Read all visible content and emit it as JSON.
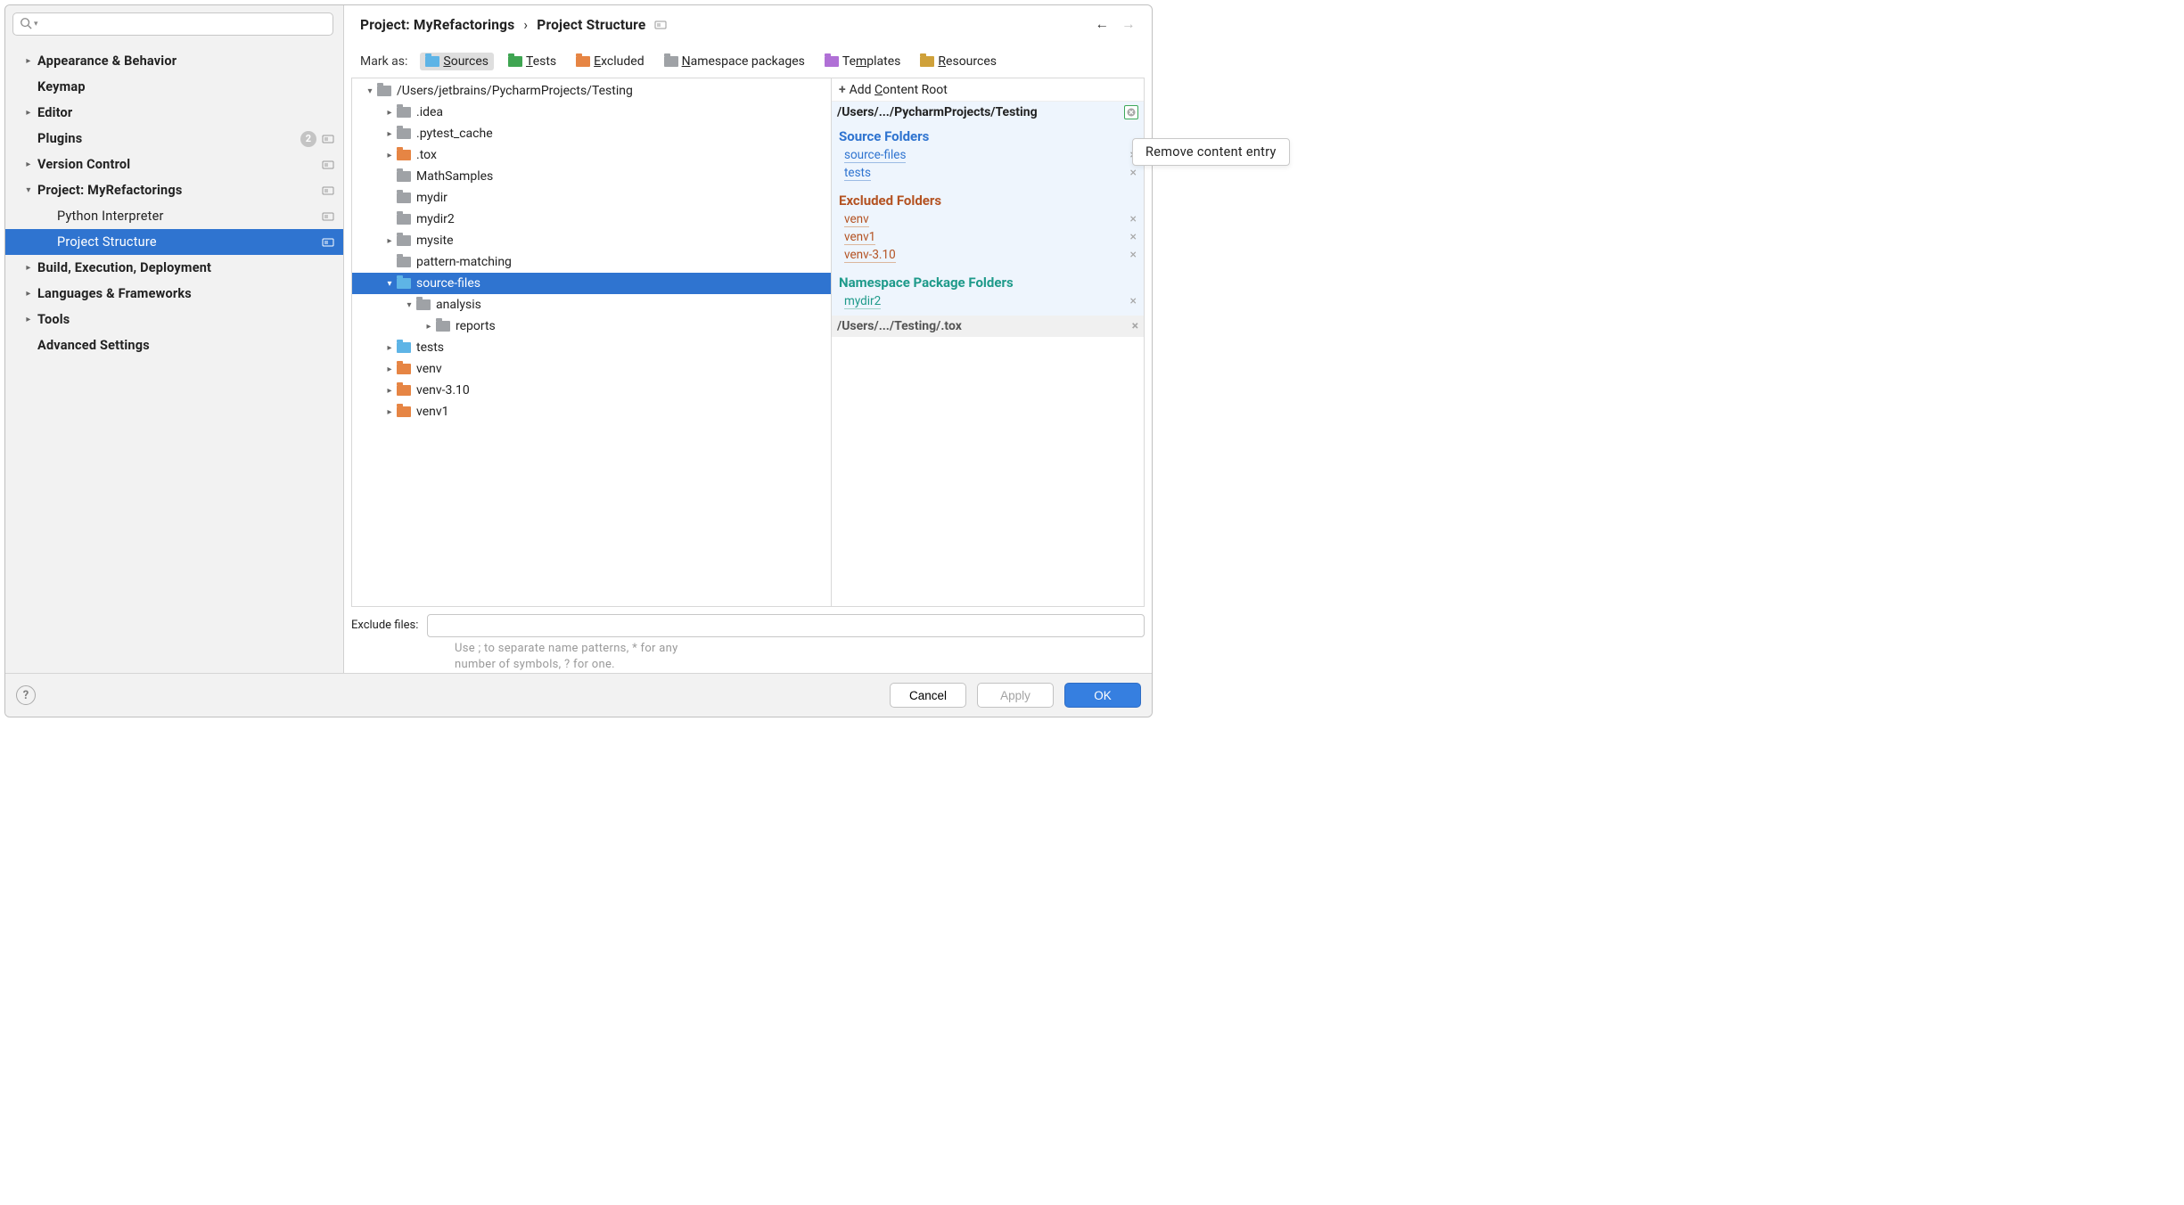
{
  "breadcrumb": {
    "part1": "Project: MyRefactorings",
    "sep": "›",
    "part2": "Project Structure"
  },
  "search": {
    "placeholder": ""
  },
  "sidebar": {
    "items": [
      {
        "label": "Appearance & Behavior",
        "arrow": "right"
      },
      {
        "label": "Keymap",
        "arrow": "none"
      },
      {
        "label": "Editor",
        "arrow": "right"
      },
      {
        "label": "Plugins",
        "arrow": "none",
        "badge": "2",
        "gear": true
      },
      {
        "label": "Version Control",
        "arrow": "right",
        "gear": true
      },
      {
        "label": "Project: MyRefactorings",
        "arrow": "down",
        "gear": true,
        "children": [
          {
            "label": "Python Interpreter",
            "gear": true
          },
          {
            "label": "Project Structure",
            "gear": true,
            "selected": true
          }
        ]
      },
      {
        "label": "Build, Execution, Deployment",
        "arrow": "right"
      },
      {
        "label": "Languages & Frameworks",
        "arrow": "right"
      },
      {
        "label": "Tools",
        "arrow": "right"
      },
      {
        "label": "Advanced Settings",
        "arrow": "none"
      }
    ]
  },
  "mark": {
    "label": "Mark as:",
    "items": [
      {
        "pre": "",
        "u": "S",
        "post": "ources",
        "color": "#5eb4e6",
        "selected": true
      },
      {
        "pre": "",
        "u": "T",
        "post": "ests",
        "color": "#3fa552"
      },
      {
        "pre": "",
        "u": "E",
        "post": "xcluded",
        "color": "#e68544"
      },
      {
        "pre": "",
        "u": "N",
        "post": "amespace packages",
        "color": "#9fa2a6"
      },
      {
        "pre": "Te",
        "u": "m",
        "post": "plates",
        "color": "#b070d6"
      },
      {
        "pre": "",
        "u": "R",
        "post": "esources",
        "color": "#cfa13a"
      }
    ]
  },
  "dirTree": [
    {
      "depth": 0,
      "arrow": "down",
      "color": "#9fa2a6",
      "label": "/Users/jetbrains/PycharmProjects/Testing"
    },
    {
      "depth": 1,
      "arrow": "right",
      "color": "#9fa2a6",
      "label": ".idea"
    },
    {
      "depth": 1,
      "arrow": "right",
      "color": "#9fa2a6",
      "label": ".pytest_cache"
    },
    {
      "depth": 1,
      "arrow": "right",
      "color": "#e68544",
      "label": ".tox"
    },
    {
      "depth": 1,
      "arrow": "none",
      "color": "#9fa2a6",
      "label": "MathSamples"
    },
    {
      "depth": 1,
      "arrow": "none",
      "color": "#9fa2a6",
      "label": "mydir"
    },
    {
      "depth": 1,
      "arrow": "none",
      "color": "#9fa2a6",
      "label": "mydir2"
    },
    {
      "depth": 1,
      "arrow": "right",
      "color": "#9fa2a6",
      "label": "mysite"
    },
    {
      "depth": 1,
      "arrow": "none",
      "color": "#9fa2a6",
      "label": "pattern-matching"
    },
    {
      "depth": 1,
      "arrow": "down",
      "color": "#5eb4e6",
      "label": "source-files",
      "selected": true
    },
    {
      "depth": 2,
      "arrow": "down",
      "color": "#9fa2a6",
      "label": "analysis"
    },
    {
      "depth": 3,
      "arrow": "right",
      "color": "#9fa2a6",
      "label": "reports"
    },
    {
      "depth": 1,
      "arrow": "right",
      "color": "#5eb4e6",
      "label": "tests"
    },
    {
      "depth": 1,
      "arrow": "right",
      "color": "#e68544",
      "label": "venv"
    },
    {
      "depth": 1,
      "arrow": "right",
      "color": "#e68544",
      "label": "venv-3.10"
    },
    {
      "depth": 1,
      "arrow": "right",
      "color": "#e68544",
      "label": "venv1"
    }
  ],
  "rightPanel": {
    "addRoot": {
      "pre": "Add ",
      "u": "C",
      "post": "ontent Root"
    },
    "root1": "/Users/.../PycharmProjects/Testing",
    "sections": [
      {
        "kind": "src",
        "title": "Source Folders",
        "items": [
          "source-files",
          "tests"
        ]
      },
      {
        "kind": "exc",
        "title": "Excluded Folders",
        "items": [
          "venv",
          "venv1",
          "venv-3.10"
        ]
      },
      {
        "kind": "ns",
        "title": "Namespace Package Folders",
        "items": [
          "mydir2"
        ]
      }
    ],
    "root2": "/Users/.../Testing/.tox"
  },
  "exclude": {
    "label": "Exclude files:",
    "hint1": "Use ; to separate name patterns, * for any",
    "hint2": "number of symbols, ? for one."
  },
  "buttons": {
    "cancel": "Cancel",
    "apply": "Apply",
    "ok": "OK"
  },
  "tooltip": "Remove content entry"
}
